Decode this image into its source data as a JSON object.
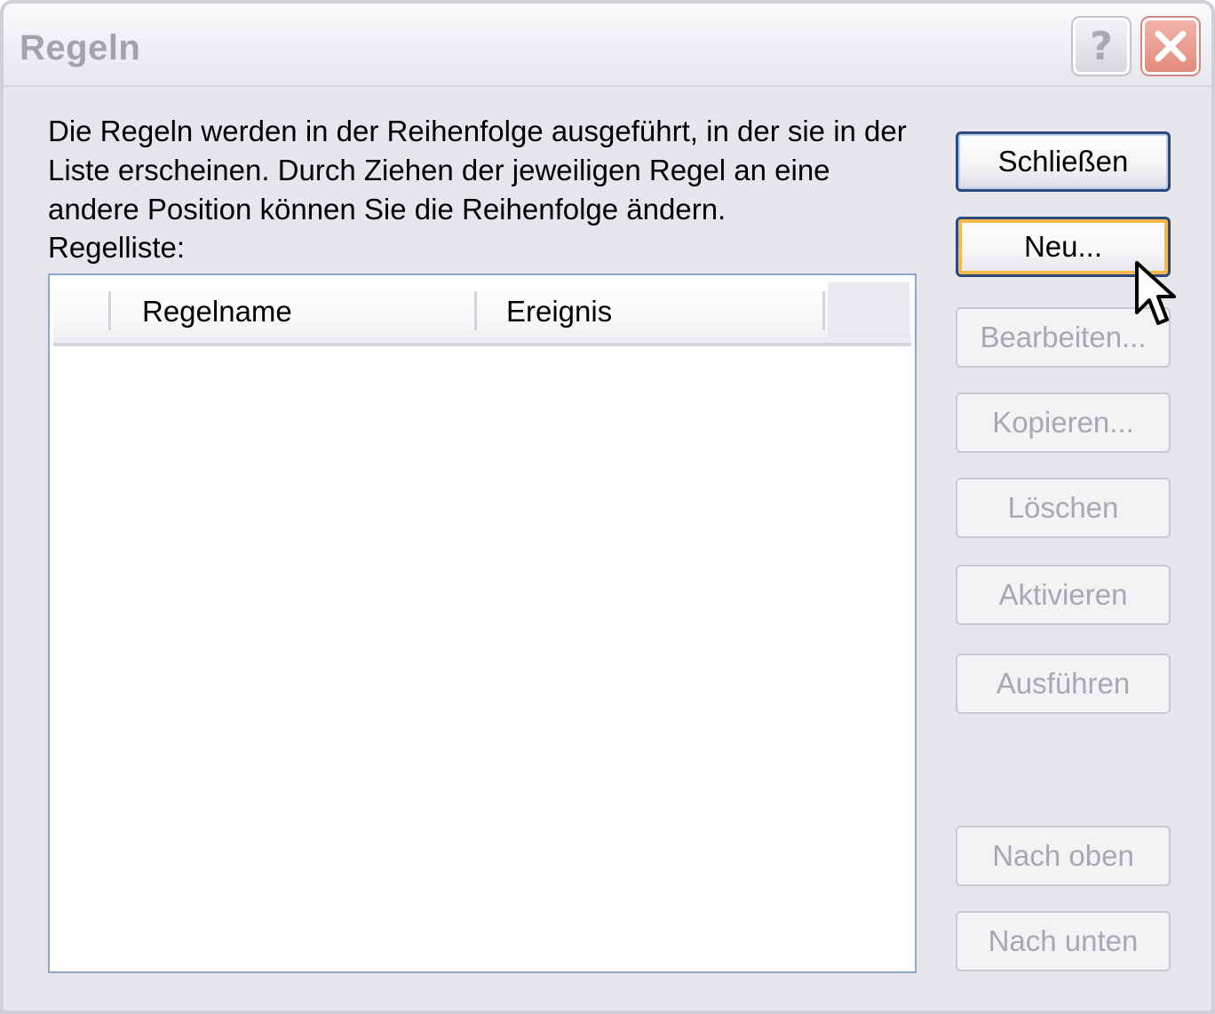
{
  "window": {
    "title": "Regeln",
    "help_glyph": "?",
    "close_icon": "close-x-icon"
  },
  "description": "Die Regeln werden in der Reihenfolge ausgeführt, in der sie in der Liste erscheinen. Durch Ziehen der jeweiligen Regel an eine andere Position können Sie die Reihenfolge ändern.",
  "list": {
    "label": "Regelliste:",
    "columns": [
      "Regelname",
      "Ereignis"
    ],
    "rows": []
  },
  "buttons": {
    "close": "Schließen",
    "new": "Neu...",
    "edit": "Bearbeiten...",
    "copy": "Kopieren...",
    "delete": "Löschen",
    "activate": "Aktivieren",
    "run": "Ausführen",
    "move_up": "Nach oben",
    "move_down": "Nach unten"
  },
  "colors": {
    "window_bg": "#e6e6ec",
    "default_button_border": "#2b4a7a",
    "focus_ring": "#f6b84c",
    "disabled_text": "#a8a8ae",
    "close_button": "#e38a7c"
  }
}
